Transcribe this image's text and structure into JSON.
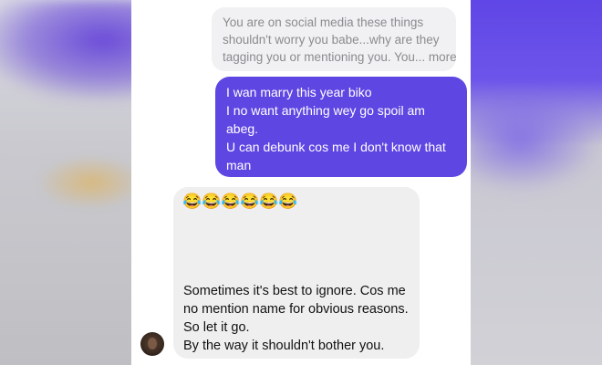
{
  "chat": {
    "quoted_message": {
      "lines": [
        "You are on social media these things",
        "shouldn't worry you babe...why are they",
        "tagging you or mentioning you. You... more"
      ]
    },
    "sent_message": {
      "lines": [
        "I wan marry this year biko",
        "I no want anything wey go spoil am",
        "abeg.",
        "U can debunk cos me I don't know that",
        "man"
      ]
    },
    "received_message": {
      "emojis": [
        "😂",
        "😂",
        "😂",
        "😂",
        "😂",
        "😂"
      ],
      "lines": [
        "Sometimes it's best to ignore. Cos me",
        "no mention name for obvious reasons.",
        "So let it go.",
        "By the way it shouldn't bother you."
      ]
    }
  },
  "colors": {
    "sent_bubble": "#5e46e3",
    "received_bubble": "#efeff0",
    "quoted_bubble": "#f1f1f3"
  }
}
